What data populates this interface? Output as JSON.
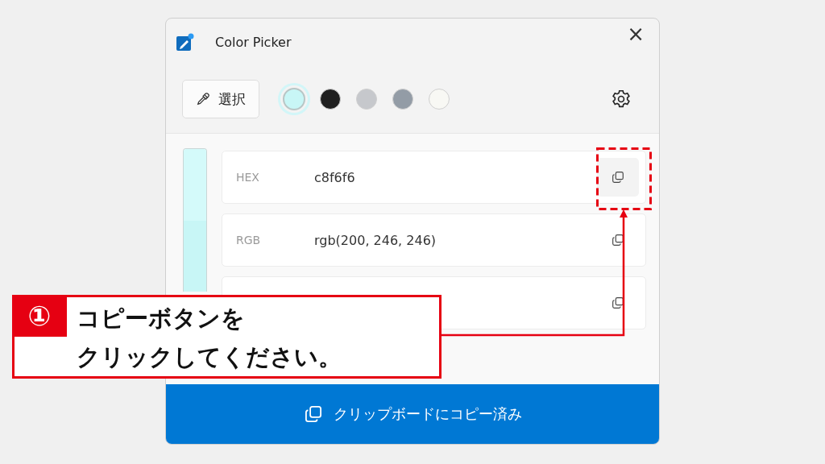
{
  "window": {
    "title": "Color Picker",
    "close": "×"
  },
  "toolbar": {
    "pick_button": "選択",
    "swatches": [
      {
        "color": "#c8f6f6",
        "selected": true
      },
      {
        "color": "#1f1f1f",
        "selected": false
      },
      {
        "color": "#c6c8cc",
        "selected": false
      },
      {
        "color": "#939ca6",
        "selected": false
      },
      {
        "color": "#f8f8f4",
        "selected": false
      }
    ]
  },
  "shades": [
    {
      "color": "#d4fafa"
    },
    {
      "color": "#c8f6f6"
    }
  ],
  "formats": [
    {
      "label": "HEX",
      "value": "c8f6f6",
      "highlighted": true
    },
    {
      "label": "RGB",
      "value": "rgb(200, 246, 246)",
      "highlighted": false
    },
    {
      "highlighted": false
    }
  ],
  "status_button": "クリップボードにコピー済み",
  "callout": {
    "number": "①",
    "lines": [
      "コピーボタンを",
      "クリックしてください。"
    ]
  }
}
